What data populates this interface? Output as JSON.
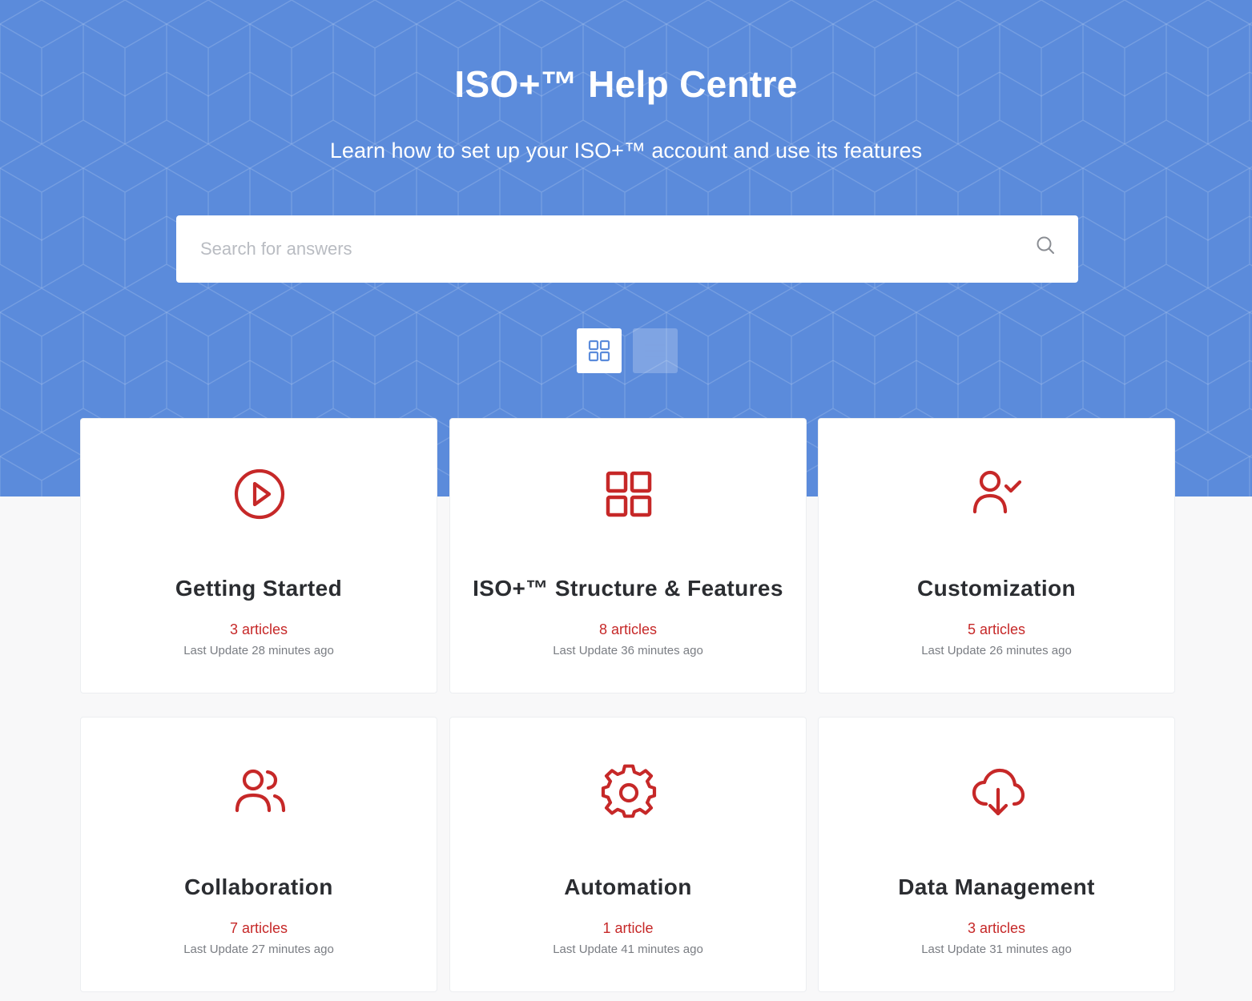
{
  "hero": {
    "title": "ISO+™ Help Centre",
    "subtitle": "Learn how to set up your ISO+™ account and use its features",
    "background_color": "#5b8bdb"
  },
  "search": {
    "placeholder": "Search for answers",
    "value": "",
    "icon": "search-icon"
  },
  "view_toggle": {
    "options": [
      {
        "icon": "grid-view-icon",
        "active": true
      },
      {
        "icon": "list-view-icon",
        "active": false
      }
    ]
  },
  "categories": [
    {
      "title": "Getting Started",
      "count": "3 articles",
      "updated": "Last Update 28 minutes ago",
      "icon": "play-circle-icon"
    },
    {
      "title": "ISO+™ Structure & Features",
      "count": "8 articles",
      "updated": "Last Update 36 minutes ago",
      "icon": "grid-squares-icon"
    },
    {
      "title": "Customization",
      "count": "5 articles",
      "updated": "Last Update 26 minutes ago",
      "icon": "user-check-icon"
    },
    {
      "title": "Collaboration",
      "count": "7 articles",
      "updated": "Last Update 27 minutes ago",
      "icon": "users-icon"
    },
    {
      "title": "Automation",
      "count": "1 article",
      "updated": "Last Update 41 minutes ago",
      "icon": "gear-icon"
    },
    {
      "title": "Data Management",
      "count": "3 articles",
      "updated": "Last Update 31 minutes ago",
      "icon": "cloud-download-icon"
    }
  ],
  "colors": {
    "accent": "#c62828",
    "page_background": "#f8f8f9",
    "title_text": "#2b2d31",
    "muted_text": "#7a7d83"
  }
}
